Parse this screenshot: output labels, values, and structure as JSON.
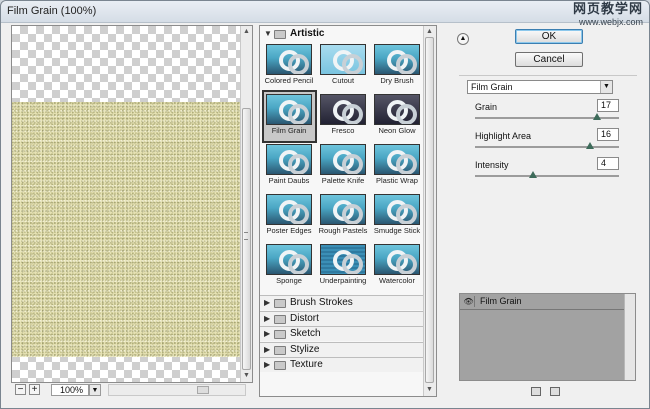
{
  "window": {
    "title": "Film Grain (100%)"
  },
  "watermark": {
    "line1": "网页教学网",
    "line2": "www.webjx.com"
  },
  "preview": {
    "zoom": "100%",
    "zoom_out": "−",
    "zoom_in": "+"
  },
  "gallery": {
    "open_category": "Artistic",
    "filters": [
      "Colored Pencil",
      "Cutout",
      "Dry Brush",
      "Film Grain",
      "Fresco",
      "Neon Glow",
      "Paint Daubs",
      "Palette Knife",
      "Plastic Wrap",
      "Poster Edges",
      "Rough Pastels",
      "Smudge Stick",
      "Sponge",
      "Underpainting",
      "Watercolor"
    ],
    "selected_filter": "Film Grain",
    "categories": [
      "Brush Strokes",
      "Distort",
      "Sketch",
      "Stylize",
      "Texture"
    ]
  },
  "buttons": {
    "ok": "OK",
    "cancel": "Cancel"
  },
  "settings": {
    "filter_select": "Film Grain",
    "params": [
      {
        "label": "Grain",
        "value": "17",
        "slider_fraction": 0.85
      },
      {
        "label": "Highlight Area",
        "value": "16",
        "slider_fraction": 0.8
      },
      {
        "label": "Intensity",
        "value": "4",
        "slider_fraction": 0.4
      }
    ]
  },
  "layers": {
    "items": [
      "Film Grain"
    ]
  }
}
